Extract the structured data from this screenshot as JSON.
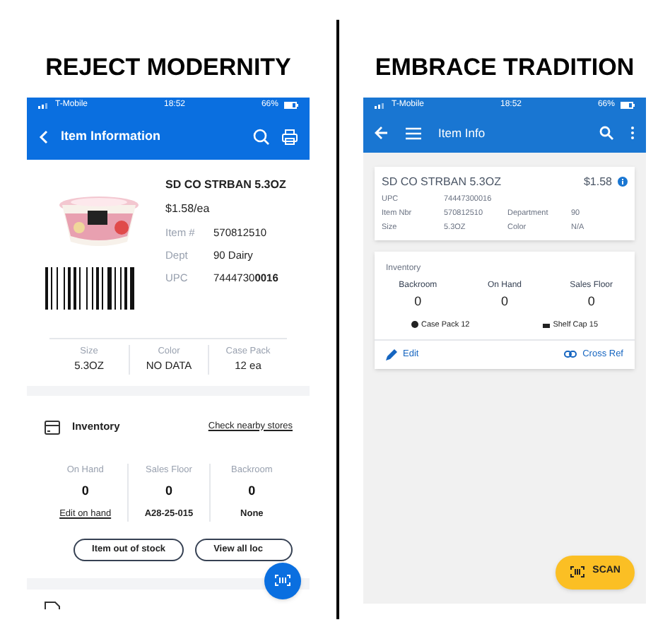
{
  "captions": [
    "REJECT MODERNITY",
    "EMBRACE TRADITION"
  ],
  "left": {
    "status": {
      "carrier": "T-Mobile",
      "time": "18:52",
      "battery": "66%"
    },
    "header": {
      "title": "Item Information"
    },
    "product": {
      "name": "SD CO STRBAN 5.3OZ",
      "price": "$1.58/ea",
      "fields": [
        {
          "label": "Item #",
          "value": "570812510"
        },
        {
          "label": "Dept",
          "value": "90 Dairy"
        },
        {
          "label": "UPC",
          "value": "7444730**0016**"
        }
      ]
    },
    "specs": [
      {
        "label": "Size",
        "value": "5.3OZ"
      },
      {
        "label": "Color",
        "value": "NO DATA"
      },
      {
        "label": "Case Pack",
        "value": "12 ea"
      }
    ],
    "inventory": {
      "title": "Inventory",
      "link": "Check nearby stores",
      "stats": [
        {
          "label": "On Hand",
          "value": "0",
          "note": "Edit on hand",
          "kind": "link"
        },
        {
          "label": "Sales Floor",
          "value": "0",
          "note": "A28-25-015",
          "kind": "text"
        },
        {
          "label": "Backroom",
          "value": "0",
          "note": "None",
          "kind": "text"
        }
      ],
      "buttons": [
        "Item out of stock",
        "View all loc"
      ]
    }
  },
  "right": {
    "status": {
      "carrier": "T-Mobile",
      "time": "18:52",
      "battery": "66%"
    },
    "header": {
      "title": "Item Info"
    },
    "item": {
      "name": "SD CO STRBAN 5.3OZ",
      "price": "$1.58",
      "upc_label": "UPC",
      "upc": "74447300016",
      "fields": [
        {
          "label": "Item Nbr",
          "value": "570812510"
        },
        {
          "label": "Department",
          "value": "90"
        },
        {
          "label": "Size",
          "value": "5.3OZ"
        },
        {
          "label": "Color",
          "value": "N/A"
        }
      ]
    },
    "inventory": {
      "title": "Inventory",
      "stats": [
        {
          "label": "Backroom",
          "value": "0"
        },
        {
          "label": "On Hand",
          "value": "0"
        },
        {
          "label": "Sales Floor",
          "value": "0"
        }
      ],
      "case_pack": "Case Pack 12",
      "shelf_cap": "Shelf Cap 15"
    },
    "actions": [
      "Edit",
      "Cross Ref"
    ],
    "scan": "SCAN"
  }
}
